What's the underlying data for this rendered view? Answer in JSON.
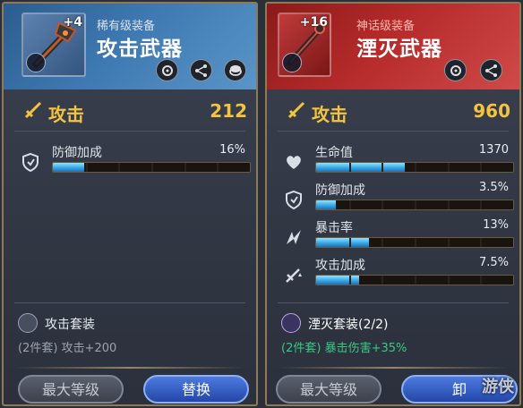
{
  "left": {
    "enhance": "+4",
    "rarity": "稀有级装备",
    "title": "攻击武器",
    "attack_label": "攻击",
    "attack_value": "212",
    "stats": [
      {
        "label": "防御加成",
        "value": "16%",
        "fill": 0.16,
        "icon": "shield-icon"
      }
    ],
    "set_name": "攻击套装",
    "set_bonus": "(2件套) 攻击+200",
    "btn_max": "最大等级",
    "btn_action": "替换"
  },
  "right": {
    "enhance": "+16",
    "rarity": "神话级装备",
    "title": "湮灭武器",
    "attack_label": "攻击",
    "attack_value": "960",
    "stats": [
      {
        "label": "生命值",
        "value": "1370",
        "fill": 0.45,
        "icon": "heart-icon"
      },
      {
        "label": "防御加成",
        "value": "3.5%",
        "fill": 0.1,
        "icon": "shield-icon"
      },
      {
        "label": "暴击率",
        "value": "13%",
        "fill": 0.27,
        "icon": "critical-icon"
      },
      {
        "label": "攻击加成",
        "value": "7.5%",
        "fill": 0.22,
        "icon": "sword-boost-icon"
      }
    ],
    "set_name": "湮灭套装(2/2)",
    "set_bonus_prefix": "(2件套)",
    "set_bonus_effect": "暴击伤害+35%",
    "btn_max": "最大等级",
    "btn_action": "卸"
  },
  "watermark": "游侠",
  "colors": {
    "rare_header": "#3d78b0",
    "mythic_header": "#b52a2a",
    "gold": "#f2c441",
    "bar_fill": "#3aa6e6",
    "set_green": "#38c983"
  }
}
